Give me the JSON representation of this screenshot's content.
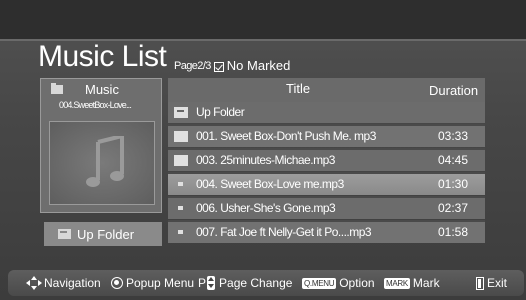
{
  "header": {
    "title": "Music List",
    "page_prefix": "Page",
    "page_value": "2/3",
    "marked_status": "No Marked"
  },
  "preview": {
    "category": "Music",
    "file_name": "004.SweetBox-Love..."
  },
  "up_folder_button": "Up Folder",
  "list": {
    "col_title": "Title",
    "col_duration": "Duration",
    "rows": [
      {
        "name": "Up Folder",
        "duration": "",
        "icon": "up-folder-icon"
      },
      {
        "name": "001. Sweet Box-Don't Push Me. mp3",
        "duration": "03:33",
        "icon": "folder-icon"
      },
      {
        "name": "003. 25minutes-Michae.mp3",
        "duration": "04:45",
        "icon": "folder-icon"
      },
      {
        "name": "004. Sweet Box-Love me.mp3",
        "duration": "01:30",
        "icon": "audio-file-icon"
      },
      {
        "name": "006. Usher-She's Gone.mp3",
        "duration": "02:37",
        "icon": "audio-file-icon"
      },
      {
        "name": "007. Fat Joe ft Nelly-Get it Po....mp3",
        "duration": "01:58",
        "icon": "audio-file-icon"
      }
    ],
    "selected_index": 3
  },
  "bottom_bar": {
    "navigation": "Navigation",
    "popup_menu": "Popup Menu",
    "page_key": "P",
    "page_change": "Page Change",
    "option_key": "Q.MENU",
    "option": "Option",
    "mark_key": "MARK",
    "mark": "Mark",
    "exit": "Exit"
  }
}
